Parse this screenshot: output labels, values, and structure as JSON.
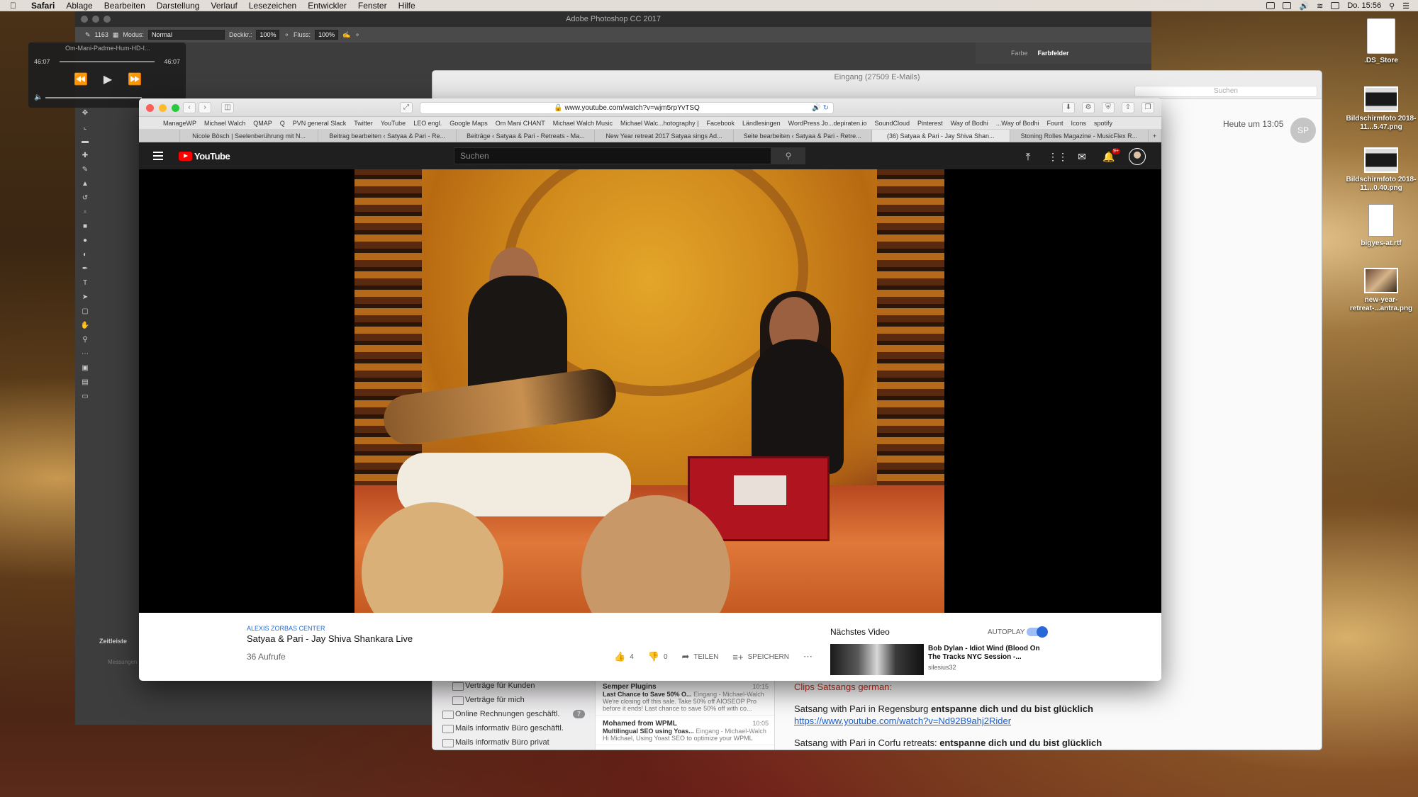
{
  "menubar": {
    "app": "Safari",
    "items": [
      "Ablage",
      "Bearbeiten",
      "Darstellung",
      "Verlauf",
      "Lesezeichen",
      "Entwickler",
      "Fenster",
      "Hilfe"
    ],
    "clock": "Do. 15:56"
  },
  "desktop": {
    "icons": [
      {
        "label": ".DS_Store"
      },
      {
        "label": "Bildschirmfoto 2018-11...5.47.png"
      },
      {
        "label": "Bildschirmfoto 2018-11...0.40.png"
      },
      {
        "label": "bigyes-at.rtf"
      },
      {
        "label": "new-year-retreat-...antra.png"
      }
    ]
  },
  "photoshop": {
    "title": "Adobe Photoshop CC 2017",
    "options": {
      "brush_size": "1163",
      "modus_label": "Modus:",
      "modus_value": "Normal",
      "deckkr_label": "Deckkr.:",
      "deckkr_value": "100%",
      "fluss_label": "Fluss:",
      "fluss_value": "100%"
    },
    "panel_tabs": [
      "Farbe",
      "Farbfelder"
    ],
    "timeline_label": "Zeitleiste",
    "messung_label": "Messungen"
  },
  "player": {
    "title": "Om-Mani-Padme-Hum-HD-I...",
    "time_elapsed": "46:07",
    "time_total": "46:07"
  },
  "mail": {
    "title": "Eingang (27509 E-Mails)",
    "search_placeholder": "Suchen",
    "date": "Heute um 13:05",
    "avatar": "SP",
    "folders": [
      {
        "label": "Verträge für Kunden",
        "sub": true
      },
      {
        "label": "Verträge für mich",
        "sub": true
      },
      {
        "label": "Online Rechnungen geschäftl.",
        "sub": false,
        "count": "7"
      },
      {
        "label": "Mails informativ Büro geschäftl.",
        "sub": false
      },
      {
        "label": "Mails informativ Büro privat",
        "sub": false
      }
    ],
    "messages": [
      {
        "from": "Semper Plugins",
        "time": "10:15",
        "subject": "Last Chance to Save 50% O...",
        "account": "Eingang - Michael-Walch",
        "snippet": "We're closing off this sale. Take 50% off AIOSEOP Pro before it ends! Last chance to save 50% off with co..."
      },
      {
        "from": "Mohamed from WPML",
        "time": "10:05",
        "subject": "Multilingual SEO using Yoas...",
        "account": "Eingang - Michael-Walch",
        "snippet": "Hi Michael, Using Yoast SEO to optimize your WPML"
      }
    ],
    "body": {
      "heading": "Clips Satsangs german:",
      "line1_a": "Satsang with Pari in Regensburg ",
      "line1_b": "entspanne dich und du bist glücklich",
      "link": "https://www.youtube.com/watch?v=Nd92B9ahj2Rider",
      "line2_a": "Satsang with Pari in Corfu retreats: ",
      "line2_b": "entspanne dich und du bist glücklich"
    }
  },
  "safari": {
    "url": "www.youtube.com/watch?v=wjm5rpYvTSQ",
    "bookmarks": [
      "ManageWP",
      "Michael Walch",
      "QMAP",
      "Q",
      "PVN general Slack",
      "Twitter",
      "YouTube",
      "LEO engl.",
      "Google Maps",
      "Om Mani CHANT",
      "Michael Walch Music",
      "Michael Walc...hotography |",
      "Facebook",
      "Ländlesingen",
      "WordPress Jo...depiraten.io",
      "SoundCloud",
      "Pinterest",
      "Way of Bodhi",
      "...Way of Bodhi",
      "Fount",
      "Icons",
      "spotify"
    ],
    "tabs": [
      {
        "label": "Nicole Bösch | Seelenberührung mit N...",
        "active": false
      },
      {
        "label": "Beitrag bearbeiten ‹ Satyaa & Pari - Re...",
        "active": false
      },
      {
        "label": "Beiträge ‹ Satyaa & Pari - Retreats - Ma...",
        "active": false
      },
      {
        "label": "New Year retreat 2017 Satyaa sings Ad...",
        "active": false
      },
      {
        "label": "Seite bearbeiten ‹ Satyaa & Pari - Retre...",
        "active": false
      },
      {
        "label": "(36) Satyaa & Pari - Jay Shiva Shan...",
        "active": true
      },
      {
        "label": "Stoning Rolles Magazine - MusicFlex R...",
        "active": false
      }
    ]
  },
  "youtube": {
    "logo": "YouTube",
    "search_placeholder": "Suchen",
    "notification_count": "9+",
    "channel": "ALEXIS ZORBAS CENTER",
    "video_title": "Satyaa & Pari - Jay Shiva Shankara Live",
    "views": "36 Aufrufe",
    "likes": "4",
    "dislikes": "0",
    "share": "TEILEN",
    "save": "SPEICHERN",
    "next_label": "Nächstes Video",
    "autoplay_label": "AUTOPLAY",
    "next_video_title": "Bob Dylan - Idiot Wind (Blood On The Tracks NYC Session -...",
    "next_video_channel": "silesius32",
    "colors": {
      "brand": "#ff0000",
      "link": "#1a6dd8",
      "toggle": "#2a68d8"
    }
  }
}
